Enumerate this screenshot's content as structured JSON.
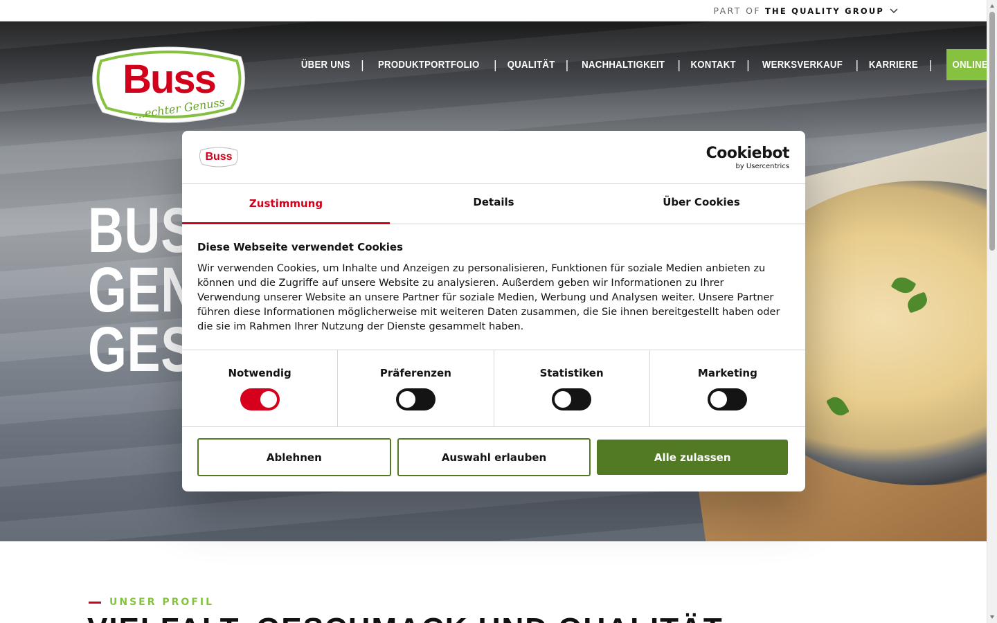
{
  "topbar": {
    "part_of": "PART OF",
    "group": "THE QUALITY GROUP"
  },
  "logo": {
    "brand": "Buss",
    "tagline": "...echter Genuss"
  },
  "nav": {
    "items": [
      "ÜBER UNS",
      "PRODUKTPORTFOLIO",
      "QUALITÄT",
      "NACHHALTIGKEIT",
      "KONTAKT",
      "WERKSVERKAUF",
      "KARRIERE"
    ],
    "separator": "|",
    "shop": "ONLINE-SHOP"
  },
  "hero": {
    "lines": [
      "BUSS",
      "GENU",
      "GESC"
    ]
  },
  "profile": {
    "label": "UNSER PROFIL",
    "title": "VIELFALT, GESCHMACK UND QUALITÄT"
  },
  "cookie": {
    "brand": "Cookiebot",
    "brand_sub": "by Usercentrics",
    "tabs": [
      "Zustimmung",
      "Details",
      "Über Cookies"
    ],
    "heading": "Diese Webseite verwendet Cookies",
    "text": "Wir verwenden Cookies, um Inhalte und Anzeigen zu personalisieren, Funktionen für soziale Medien anbieten zu können und die Zugriffe auf unsere Website zu analysieren. Außerdem geben wir Informationen zu Ihrer Verwendung unserer Website an unsere Partner für soziale Medien, Werbung und Analysen weiter. Unsere Partner führen diese Informationen möglicherweise mit weiteren Daten zusammen, die Sie ihnen bereitgestellt haben oder die sie im Rahmen Ihrer Nutzung der Dienste gesammelt haben.",
    "toggles": [
      {
        "label": "Notwendig",
        "on": true
      },
      {
        "label": "Präferenzen",
        "on": false
      },
      {
        "label": "Statistiken",
        "on": false
      },
      {
        "label": "Marketing",
        "on": false
      }
    ],
    "buttons": {
      "decline": "Ablehnen",
      "allow_selection": "Auswahl erlauben",
      "allow_all": "Alle zulassen"
    },
    "colors": {
      "accent_red": "#d2001a",
      "button_green": "#527a25",
      "shop_green": "#86c240"
    }
  }
}
